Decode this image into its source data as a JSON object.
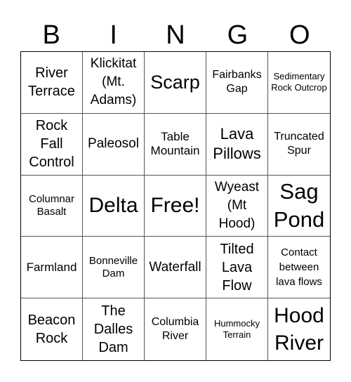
{
  "header": {
    "letters": [
      "B",
      "I",
      "N",
      "G",
      "O"
    ]
  },
  "board": {
    "rows": [
      [
        "River Terrace",
        "Klickitat (Mt. Adams)",
        "Scarp",
        "Fairbanks Gap",
        "Sedimentary Rock Outcrop"
      ],
      [
        "Rock Fall Control",
        "Paleosol",
        "Table Mountain",
        "Lava Pillows",
        "Truncated Spur"
      ],
      [
        "Columnar Basalt",
        "Delta",
        "Free!",
        "Wyeast (Mt Hood)",
        "Sag Pond"
      ],
      [
        "Farmland",
        "Bonneville Dam",
        "Waterfall",
        "Tilted Lava Flow",
        "Contact between lava flows"
      ],
      [
        "Beacon Rock",
        "The Dalles Dam",
        "Columbia River",
        "Hummocky Terrain",
        "Hood River"
      ]
    ]
  }
}
